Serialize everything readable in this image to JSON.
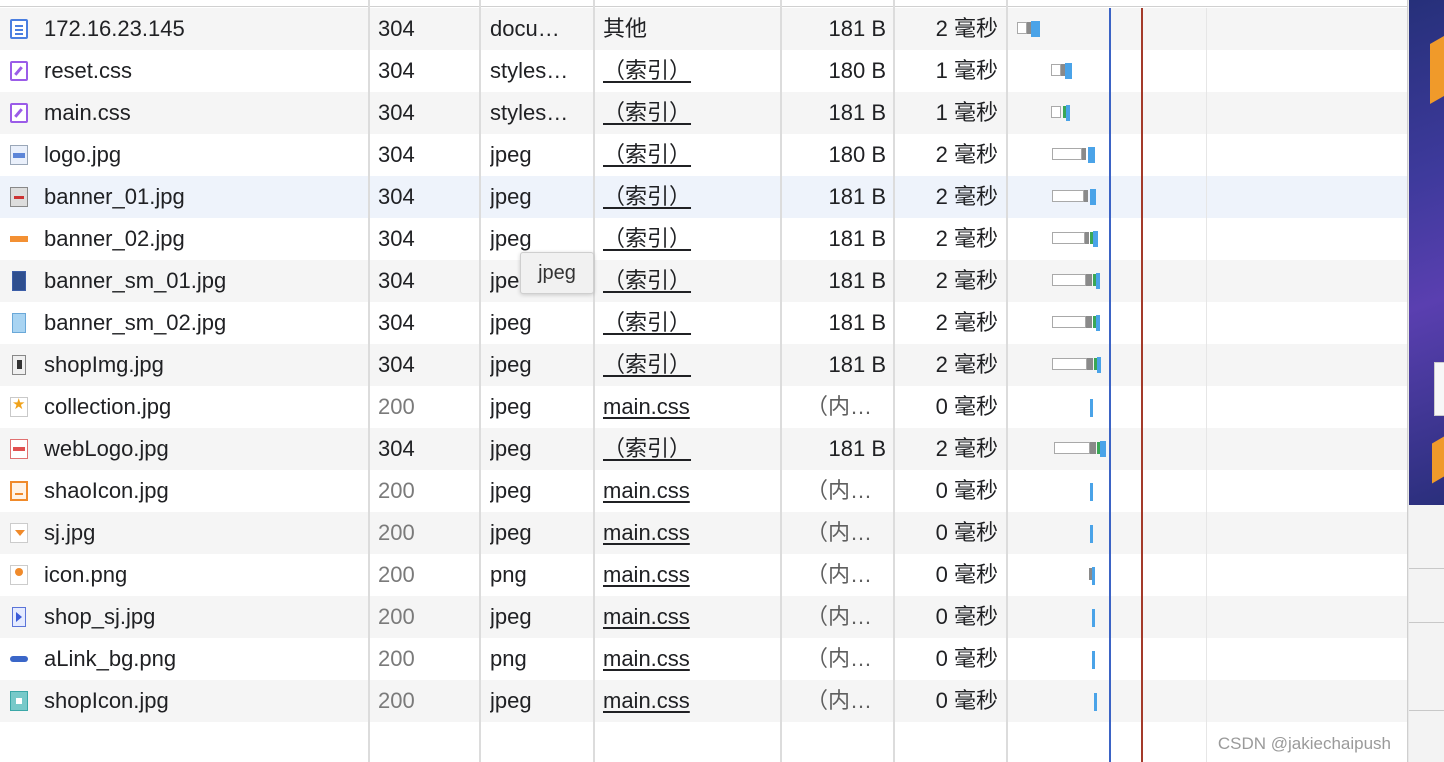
{
  "requests": [
    {
      "name": "172.16.23.145",
      "status": "304",
      "type": "docu…",
      "initiator": "其他",
      "initiator_link": false,
      "size": "181 B",
      "time": "2 毫秒",
      "icon": "document-icon"
    },
    {
      "name": "reset.css",
      "status": "304",
      "type": "styles…",
      "initiator": "（索引）",
      "initiator_link": true,
      "size": "180 B",
      "time": "1 毫秒",
      "icon": "stylesheet-icon"
    },
    {
      "name": "main.css",
      "status": "304",
      "type": "styles…",
      "initiator": "（索引）",
      "initiator_link": true,
      "size": "181 B",
      "time": "1 毫秒",
      "icon": "stylesheet-icon"
    },
    {
      "name": "logo.jpg",
      "status": "304",
      "type": "jpeg",
      "initiator": "（索引）",
      "initiator_link": true,
      "size": "180 B",
      "time": "2 毫秒",
      "icon": "image-thumbnail-icon"
    },
    {
      "name": "banner_01.jpg",
      "status": "304",
      "type": "jpeg",
      "initiator": "（索引）",
      "initiator_link": true,
      "size": "181 B",
      "time": "2 毫秒",
      "icon": "image-thumbnail-icon"
    },
    {
      "name": "banner_02.jpg",
      "status": "304",
      "type": "jpeg",
      "initiator": "（索引）",
      "initiator_link": true,
      "size": "181 B",
      "time": "2 毫秒",
      "icon": "image-thumbnail-icon"
    },
    {
      "name": "banner_sm_01.jpg",
      "status": "304",
      "type": "jpeg",
      "initiator": "（索引）",
      "initiator_link": true,
      "size": "181 B",
      "time": "2 毫秒",
      "icon": "image-thumbnail-icon"
    },
    {
      "name": "banner_sm_02.jpg",
      "status": "304",
      "type": "jpeg",
      "initiator": "（索引）",
      "initiator_link": true,
      "size": "181 B",
      "time": "2 毫秒",
      "icon": "image-thumbnail-icon"
    },
    {
      "name": "shopImg.jpg",
      "status": "304",
      "type": "jpeg",
      "initiator": "（索引）",
      "initiator_link": true,
      "size": "181 B",
      "time": "2 毫秒",
      "icon": "image-thumbnail-icon"
    },
    {
      "name": "collection.jpg",
      "status": "200",
      "type": "jpeg",
      "initiator": "main.css",
      "initiator_link": true,
      "size": "（内…",
      "time": "0 毫秒",
      "icon": "star-thumbnail-icon"
    },
    {
      "name": "webLogo.jpg",
      "status": "304",
      "type": "jpeg",
      "initiator": "（索引）",
      "initiator_link": true,
      "size": "181 B",
      "time": "2 毫秒",
      "icon": "image-thumbnail-icon"
    },
    {
      "name": "shaoIcon.jpg",
      "status": "200",
      "type": "jpeg",
      "initiator": "main.css",
      "initiator_link": true,
      "size": "（内…",
      "time": "0 毫秒",
      "icon": "cart-thumbnail-icon"
    },
    {
      "name": "sj.jpg",
      "status": "200",
      "type": "jpeg",
      "initiator": "main.css",
      "initiator_link": true,
      "size": "（内…",
      "time": "0 毫秒",
      "icon": "arrow-thumbnail-icon"
    },
    {
      "name": "icon.png",
      "status": "200",
      "type": "png",
      "initiator": "main.css",
      "initiator_link": true,
      "size": "（内…",
      "time": "0 毫秒",
      "icon": "image-thumbnail-icon"
    },
    {
      "name": "shop_sj.jpg",
      "status": "200",
      "type": "jpeg",
      "initiator": "main.css",
      "initiator_link": true,
      "size": "（内…",
      "time": "0 毫秒",
      "icon": "image-thumbnail-icon"
    },
    {
      "name": "aLink_bg.png",
      "status": "200",
      "type": "png",
      "initiator": "main.css",
      "initiator_link": true,
      "size": "（内…",
      "time": "0 毫秒",
      "icon": "image-thumbnail-icon"
    },
    {
      "name": "shopIcon.jpg",
      "status": "200",
      "type": "jpeg",
      "initiator": "main.css",
      "initiator_link": true,
      "size": "（内…",
      "time": "0 毫秒",
      "icon": "image-thumbnail-icon"
    }
  ],
  "tooltip": {
    "text": "jpeg"
  },
  "watermark": "CSDN @jakiechaipush",
  "colors": {
    "dom_content_loaded_line": "#3b63c5",
    "load_line": "#a33a2a",
    "waterfall_bar": "#4aa3e8",
    "waterfall_green": "#3aa757"
  }
}
